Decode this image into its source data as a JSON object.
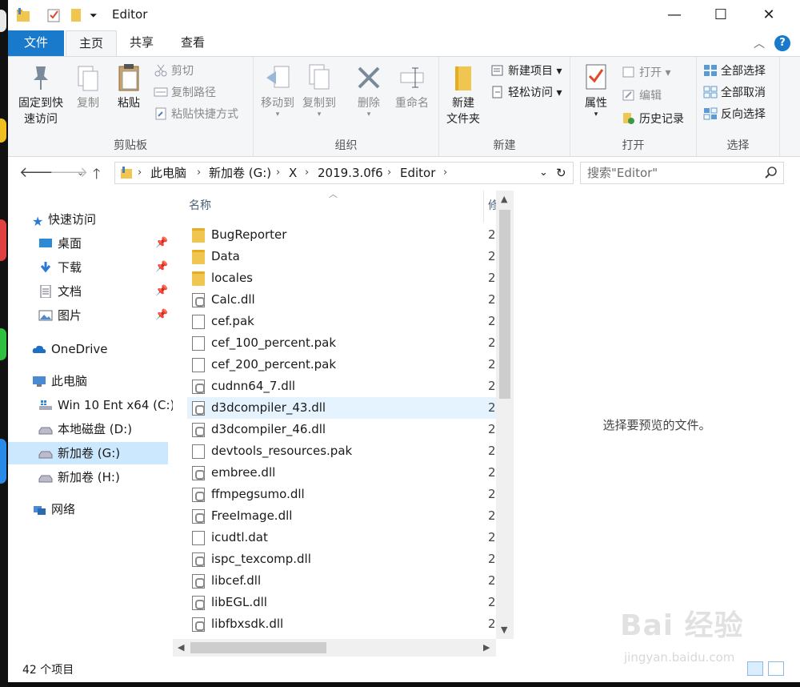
{
  "window": {
    "title": "Editor",
    "controls": {
      "minimize": "—",
      "maximize": "☐",
      "close": "✕"
    }
  },
  "ribbon_tabs": [
    {
      "label": "文件"
    },
    {
      "label": "主页"
    },
    {
      "label": "共享"
    },
    {
      "label": "查看"
    }
  ],
  "ribbon": {
    "clipboard": {
      "label": "剪贴板",
      "pin": "固定到快\n速访问",
      "pin_line1": "固定到快",
      "pin_line2": "速访问",
      "copy": "复制",
      "paste": "粘贴",
      "cut": "剪切",
      "copy_path": "复制路径",
      "paste_shortcut": "粘贴快捷方式"
    },
    "organize": {
      "label": "组织",
      "move_to": "移动到",
      "copy_to": "复制到",
      "delete": "删除",
      "rename": "重命名"
    },
    "new": {
      "label": "新建",
      "new_folder_line1": "新建",
      "new_folder_line2": "文件夹",
      "new_item": "新建项目",
      "easy_access": "轻松访问"
    },
    "open": {
      "label": "打开",
      "properties": "属性",
      "open": "打开",
      "edit": "编辑",
      "history": "历史记录"
    },
    "select": {
      "label": "选择",
      "select_all": "全部选择",
      "select_none": "全部取消",
      "invert": "反向选择"
    }
  },
  "address": {
    "crumbs": [
      "此电脑",
      "新加卷 (G:)",
      "X",
      "2019.3.0f6",
      "Editor"
    ]
  },
  "search": {
    "placeholder": "搜索\"Editor\""
  },
  "sidebar": {
    "quick_access": "快速访问",
    "quick_items": [
      "桌面",
      "下载",
      "文档",
      "图片"
    ],
    "onedrive": "OneDrive",
    "this_pc": "此电脑",
    "drives": [
      "Win 10 Ent x64 (C:)",
      "本地磁盘 (D:)",
      "新加卷 (G:)",
      "新加卷 (H:)"
    ],
    "network": "网络"
  },
  "file_list": {
    "col_name": "名称",
    "col_date": "修",
    "date_prefix": "2",
    "files": [
      {
        "name": "BugReporter",
        "type": "folder"
      },
      {
        "name": "Data",
        "type": "folder"
      },
      {
        "name": "locales",
        "type": "folder"
      },
      {
        "name": "Calc.dll",
        "type": "dll"
      },
      {
        "name": "cef.pak",
        "type": "file"
      },
      {
        "name": "cef_100_percent.pak",
        "type": "file"
      },
      {
        "name": "cef_200_percent.pak",
        "type": "file"
      },
      {
        "name": "cudnn64_7.dll",
        "type": "dll"
      },
      {
        "name": "d3dcompiler_43.dll",
        "type": "dll",
        "selected": true
      },
      {
        "name": "d3dcompiler_46.dll",
        "type": "dll"
      },
      {
        "name": "devtools_resources.pak",
        "type": "file"
      },
      {
        "name": "embree.dll",
        "type": "dll"
      },
      {
        "name": "ffmpegsumo.dll",
        "type": "dll"
      },
      {
        "name": "FreeImage.dll",
        "type": "dll"
      },
      {
        "name": "icudtl.dat",
        "type": "file"
      },
      {
        "name": "ispc_texcomp.dll",
        "type": "dll"
      },
      {
        "name": "libcef.dll",
        "type": "dll"
      },
      {
        "name": "libEGL.dll",
        "type": "dll"
      },
      {
        "name": "libfbxsdk.dll",
        "type": "dll"
      }
    ]
  },
  "preview": {
    "message": "选择要预览的文件。"
  },
  "status": {
    "count": "42 个项目"
  },
  "watermark": {
    "main": "Bai  经验",
    "sub": "jingyan.baidu.com"
  },
  "colors": {
    "accent": "#1979ca",
    "selected_row": "#e5f3ff",
    "selected_nav": "#cce8ff",
    "folder": "#f1c650"
  }
}
